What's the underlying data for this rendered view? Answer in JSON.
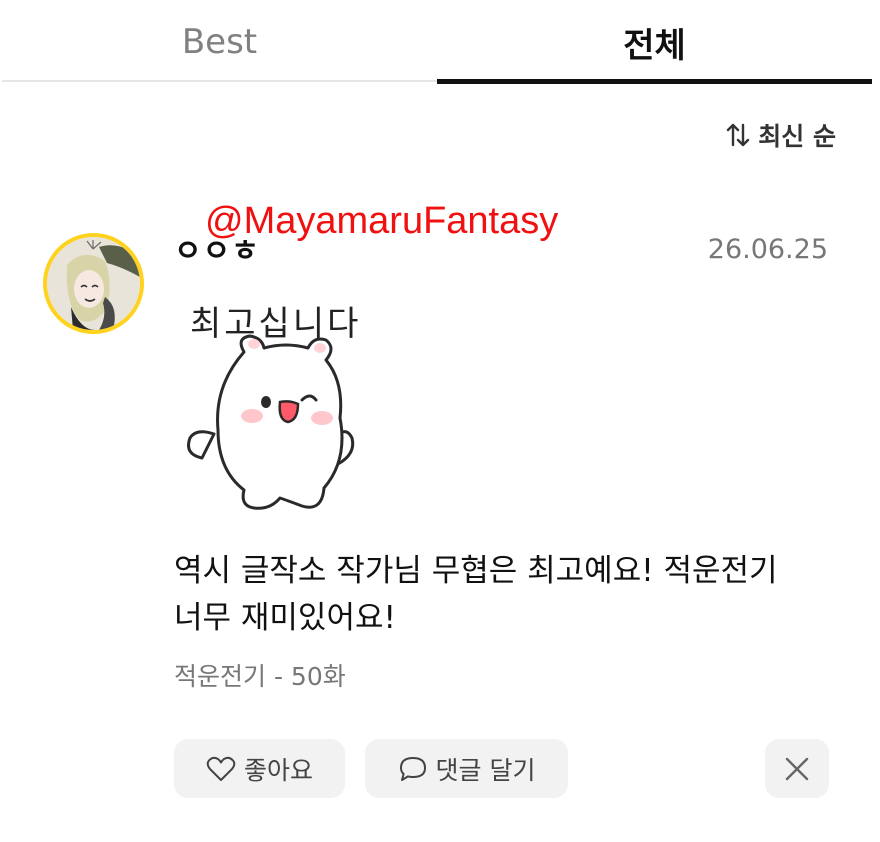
{
  "tabs": [
    {
      "label": "Best",
      "active": false
    },
    {
      "label": "전체",
      "active": true
    }
  ],
  "sort": {
    "label": "최신 순",
    "icon": "sort-arrows-icon"
  },
  "comment": {
    "nickname": "ㅇㅇㅎ",
    "watermark": "@MayamaruFantasy",
    "date": "26.06.25",
    "sticker_caption": "최고십니다",
    "body": "역시 글작소 작가님 무협은 최고예요! 적운전기 너무 재미있어요!",
    "episode": "적운전기 - 50화"
  },
  "actions": {
    "like_label": "좋아요",
    "like_icon": "heart-icon",
    "reply_label": "댓글 달기",
    "reply_icon": "speech-bubble-icon",
    "close_icon": "close-icon"
  },
  "colors": {
    "accent_underline": "#111111",
    "avatar_border": "#ffd21e",
    "watermark": "#f01010",
    "button_bg": "#f2f2f2"
  }
}
